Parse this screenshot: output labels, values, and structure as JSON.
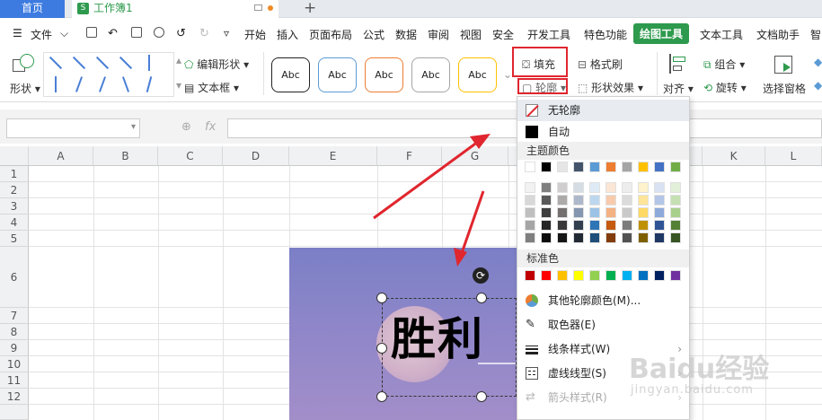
{
  "tabs": {
    "home": "首页",
    "workbook": "工作簿1",
    "workbook_badge": "S",
    "add": "+"
  },
  "menubar": {
    "file": "文件",
    "items": [
      "开始",
      "插入",
      "页面布局",
      "公式",
      "数据",
      "审阅",
      "视图",
      "安全",
      "开发工具",
      "特色功能",
      "绘图工具",
      "文本工具",
      "文档助手",
      "智"
    ],
    "active": "绘图工具"
  },
  "ribbon": {
    "shape": "形状",
    "edit_shape": "编辑形状",
    "text_box": "文本框",
    "style_label": "Abc",
    "fill": "填充",
    "outline": "轮廓",
    "format_brush": "格式刷",
    "shape_effect": "形状效果",
    "align": "对齐",
    "group": "组合",
    "rotate": "旋转",
    "selection_pane": "选择窗格"
  },
  "formula": {
    "fx": "fx"
  },
  "columns": [
    "A",
    "B",
    "C",
    "D",
    "E",
    "F",
    "G",
    "H",
    "I",
    "J",
    "K",
    "L"
  ],
  "rows": [
    "1",
    "2",
    "3",
    "4",
    "5",
    "6",
    "7",
    "8",
    "9",
    "10",
    "11",
    "12"
  ],
  "textbox_content": "胜利",
  "dropdown": {
    "no_outline": "无轮廓",
    "auto": "自动",
    "theme_colors": "主题颜色",
    "standard_colors": "标准色",
    "other_colors": "其他轮廓颜色(M)...",
    "eyedropper": "取色器(E)",
    "line_style": "线条样式(W)",
    "dash_style": "虚线线型(S)",
    "arrow_style": "箭头样式(R)"
  },
  "colors": {
    "accent_green": "#2e9a4d",
    "accent_blue": "#3d7be0",
    "annotation_red": "#e0262e",
    "theme_top": [
      "#ffffff",
      "#000000",
      "#e7e6e6",
      "#44546a",
      "#5b9bd5",
      "#ed7d31",
      "#a5a5a5",
      "#ffc000",
      "#4472c4",
      "#70ad47"
    ],
    "theme_shades": [
      [
        "#f2f2f2",
        "#7f7f7f",
        "#d0cece",
        "#d6dce4",
        "#deebf6",
        "#fbe5d5",
        "#ededed",
        "#fff2cc",
        "#d9e2f3",
        "#e2efd9"
      ],
      [
        "#d8d8d8",
        "#595959",
        "#aeaaaa",
        "#adb9ca",
        "#bdd7ee",
        "#f7cbac",
        "#dbdbdb",
        "#fee599",
        "#b4c6e7",
        "#c5e0b3"
      ],
      [
        "#bfbfbf",
        "#3f3f3f",
        "#757070",
        "#8496b0",
        "#9cc3e5",
        "#f4b183",
        "#c9c9c9",
        "#ffd965",
        "#8eaadb",
        "#a8d08d"
      ],
      [
        "#a5a5a5",
        "#262626",
        "#3a3838",
        "#323f4f",
        "#2e75b5",
        "#c55a11",
        "#7b7b7b",
        "#bf9000",
        "#2f5496",
        "#538135"
      ],
      [
        "#7f7f7f",
        "#0c0c0c",
        "#171616",
        "#222a35",
        "#1e4e79",
        "#833c0b",
        "#525252",
        "#7f6000",
        "#1f3864",
        "#375623"
      ]
    ],
    "standard": [
      "#c00000",
      "#ff0000",
      "#ffc000",
      "#ffff00",
      "#92d050",
      "#00b050",
      "#00b0f0",
      "#0070c0",
      "#002060",
      "#7030a0"
    ]
  },
  "watermark": {
    "main": "Baidu经验",
    "sub": "jingyan.baidu.com"
  }
}
